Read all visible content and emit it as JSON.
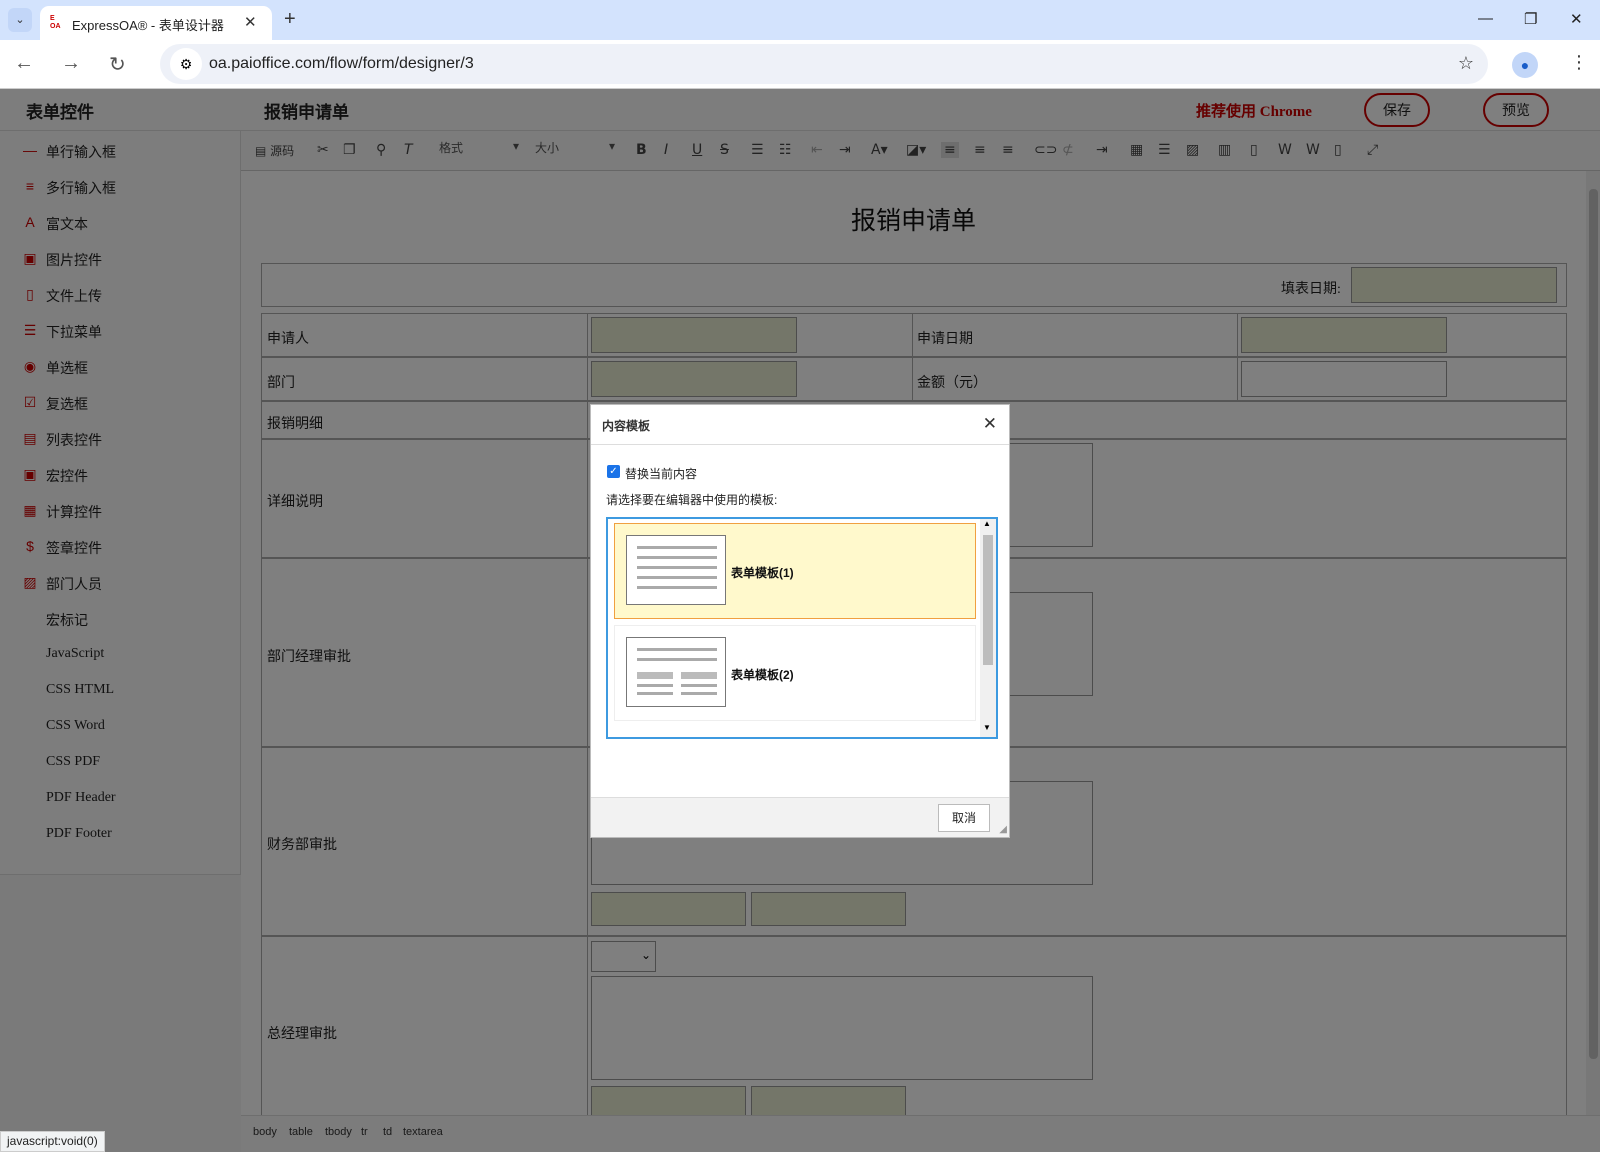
{
  "browser": {
    "tab_title": "ExpressOA® - 表单设计器",
    "favicon_text": "E OA",
    "url": "oa.paioffice.com/flow/form/designer/3"
  },
  "header": {
    "sidebar_title": "表单控件",
    "form_title": "报销申请单",
    "recommend": "推荐使用 Chrome",
    "save_label": "保存",
    "preview_label": "预览"
  },
  "sidebar": {
    "items": [
      {
        "label": "单行输入框",
        "icon": "single-line-icon"
      },
      {
        "label": "多行输入框",
        "icon": "multi-line-icon"
      },
      {
        "label": "富文本",
        "icon": "rich-text-icon"
      },
      {
        "label": "图片控件",
        "icon": "image-icon"
      },
      {
        "label": "文件上传",
        "icon": "file-upload-icon"
      },
      {
        "label": "下拉菜单",
        "icon": "dropdown-icon"
      },
      {
        "label": "单选框",
        "icon": "radio-icon"
      },
      {
        "label": "复选框",
        "icon": "checkbox-icon"
      },
      {
        "label": "列表控件",
        "icon": "list-icon"
      },
      {
        "label": "宏控件",
        "icon": "macro-icon"
      },
      {
        "label": "计算控件",
        "icon": "calculator-icon"
      },
      {
        "label": "签章控件",
        "icon": "signature-icon"
      },
      {
        "label": "部门人员",
        "icon": "department-icon"
      },
      {
        "label": "宏标记",
        "icon": ""
      },
      {
        "label": "JavaScript",
        "icon": ""
      },
      {
        "label": "CSS HTML",
        "icon": ""
      },
      {
        "label": "CSS Word",
        "icon": ""
      },
      {
        "label": "CSS PDF",
        "icon": ""
      },
      {
        "label": "PDF Header",
        "icon": ""
      },
      {
        "label": "PDF Footer",
        "icon": ""
      }
    ]
  },
  "editor_toolbar": {
    "source_label": "源码",
    "format_label": "格式",
    "size_label": "大小"
  },
  "form": {
    "title": "报销申请单",
    "fill_date_label": "填表日期:",
    "applicant_label": "申请人",
    "apply_date_label": "申请日期",
    "dept_label": "部门",
    "amount_label": "金额（元）",
    "detail_header": "报销明细",
    "detail_desc_label": "详细说明",
    "dept_mgr_label": "部门经理审批",
    "finance_label": "财务部审批",
    "gm_label": "总经理审批"
  },
  "status_path": [
    "body",
    "table",
    "tbody",
    "tr",
    "td",
    "textarea"
  ],
  "status_url": "javascript:void(0)",
  "dialog": {
    "title": "内容模板",
    "replace_label": "替换当前内容",
    "replace_checked": true,
    "instruction": "请选择要在编辑器中使用的模板:",
    "templates": [
      {
        "name": "表单模板(1)",
        "selected": true
      },
      {
        "name": "表单模板(2)",
        "selected": false
      }
    ],
    "cancel_label": "取消"
  }
}
